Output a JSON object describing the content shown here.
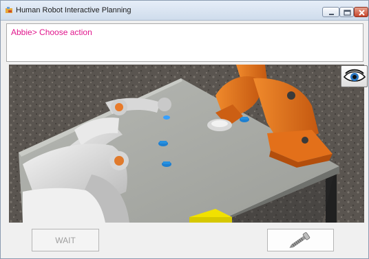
{
  "window": {
    "title": "Human Robot Interactive Planning"
  },
  "message": {
    "text": "Abbie> Choose action"
  },
  "buttons": {
    "wait_label": "WAIT"
  },
  "icons": {
    "app": "app-icon",
    "view": "eye-icon",
    "tool": "screw-icon",
    "minimize": "minimize-icon",
    "maximize": "maximize-icon",
    "close": "close-icon"
  },
  "colors": {
    "message_text": "#e0168c",
    "table_top": "#a7a9a4",
    "orange_robot": "#e3701a",
    "cups": "#1e7fd0",
    "yellow_block": "#f1e100"
  }
}
